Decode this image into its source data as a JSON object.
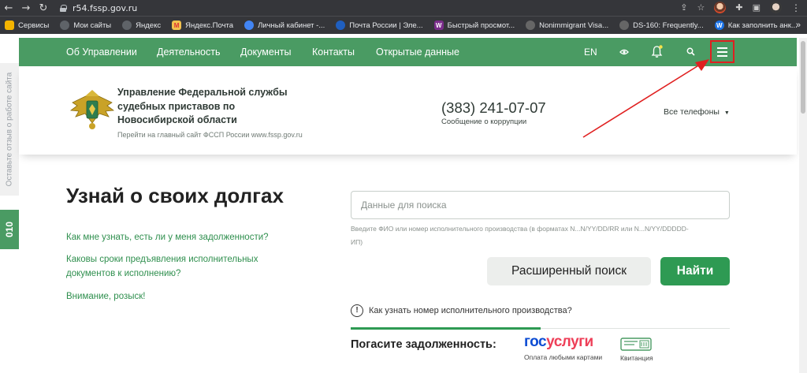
{
  "browser": {
    "url": "r54.fssp.gov.ru",
    "bookmarks": [
      {
        "label": "Сервисы",
        "color": "#f4b400",
        "icon": "apps-grid-icon"
      },
      {
        "label": "Мои сайты",
        "color": "#5f6368",
        "icon": "globe-icon"
      },
      {
        "label": "Яндекс",
        "color": "#5f6368",
        "icon": "globe-icon"
      },
      {
        "label": "Яндекс.Почта",
        "color": "#f2c14e",
        "icon": "mail-icon"
      },
      {
        "label": "Личный кабинет -...",
        "color": "#4285f4",
        "icon": "dots-icon"
      },
      {
        "label": "Почта России | Эле...",
        "color": "#1f5fbf",
        "icon": "post-icon"
      },
      {
        "label": "Быстрый просмот...",
        "color": "#7b2d8b",
        "icon": "w-icon"
      },
      {
        "label": "Nonimmigrant Visa...",
        "color": "#666666",
        "icon": "seal-icon"
      },
      {
        "label": "DS-160: Frequently...",
        "color": "#666666",
        "icon": "seal-icon"
      },
      {
        "label": "Как заполнить анк...",
        "color": "#1a73e8",
        "icon": "w-icon"
      }
    ],
    "bookmarks_more": "»"
  },
  "nav": {
    "items": [
      "Об Управлении",
      "Деятельность",
      "Документы",
      "Контакты",
      "Открытые данные"
    ],
    "lang": "EN",
    "accent_color": "#4a9b63",
    "highlight_color": "#e02020"
  },
  "side": {
    "feedback": "Оставьте отзыв о работе сайта",
    "badge": "010"
  },
  "header": {
    "org_name": "Управление Федеральной службы судебных приставов по Новосибирской области",
    "main_site_link": "Перейти на главный сайт ФССП России www.fssp.gov.ru",
    "phone": "(383) 241-07-07",
    "phone_sub": "Сообщение о коррупции",
    "all_phones": "Все телефоны"
  },
  "main": {
    "title": "Узнай о своих долгах",
    "links": [
      "Как мне узнать, есть ли у меня задолженности?",
      "Каковы сроки предъявления исполнительных документов к исполнению?",
      "Внимание, розыск!"
    ],
    "search_placeholder": "Данные для поиска",
    "search_hint": "Введите ФИО или номер исполнительного производства (в форматах N...N/YY/DD/RR или N...N/YY/DDDDD-ИП)",
    "advanced_search": "Расширенный поиск",
    "find": "Найти",
    "info_text": "Как узнать номер исполнительного производства?",
    "pay_title": "Погасите задолженность:",
    "gosuslugi_a": "гос",
    "gosuslugi_b": "услуги",
    "gosuslugi_sub": "Оплата любыми картами",
    "receipt": "Квитанция"
  }
}
